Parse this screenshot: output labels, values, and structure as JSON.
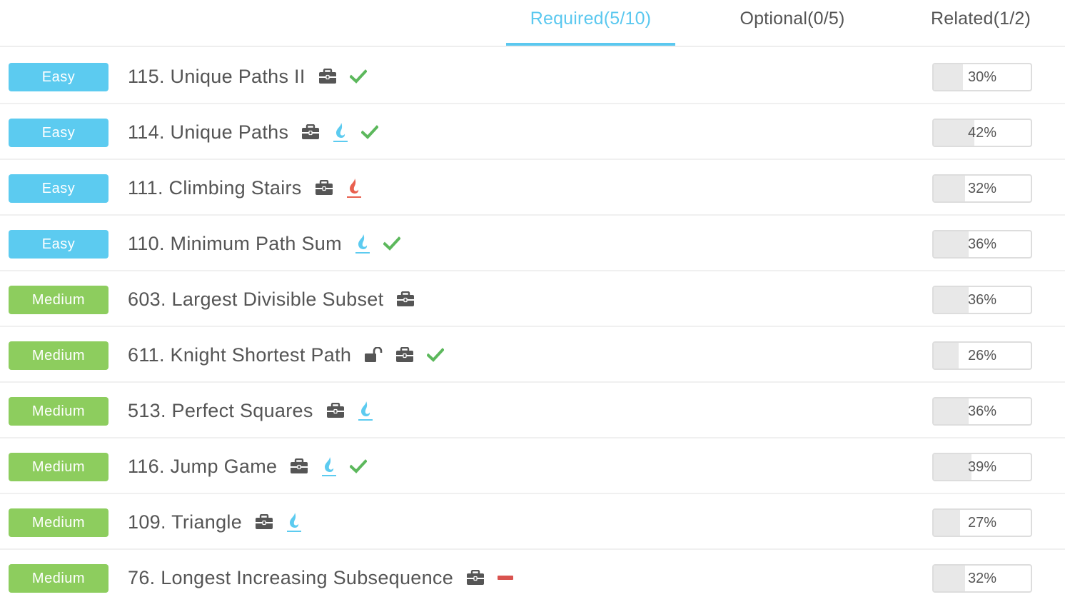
{
  "tabs": [
    {
      "label": "Required(5/10)",
      "active": true
    },
    {
      "label": "Optional(0/5)",
      "active": false
    },
    {
      "label": "Related(1/2)",
      "active": false
    }
  ],
  "colors": {
    "accent": "#5bc8ef",
    "easy": "#5ccbf0",
    "medium": "#8dcd5e",
    "check": "#5cb85c",
    "flame_blue": "#5ccbf0",
    "flame_red": "#e9604f",
    "dash_red": "#d9534f",
    "icon_gray": "#555555"
  },
  "problems": [
    {
      "difficulty": "Easy",
      "title": "115. Unique Paths II",
      "icons": [
        "briefcase-icon",
        "check-icon"
      ],
      "acceptance": "30%",
      "acceptance_value": 30
    },
    {
      "difficulty": "Easy",
      "title": "114. Unique Paths",
      "icons": [
        "briefcase-icon",
        "flame-blue-icon",
        "check-icon"
      ],
      "acceptance": "42%",
      "acceptance_value": 42
    },
    {
      "difficulty": "Easy",
      "title": "111. Climbing Stairs",
      "icons": [
        "briefcase-icon",
        "flame-red-icon"
      ],
      "acceptance": "32%",
      "acceptance_value": 32
    },
    {
      "difficulty": "Easy",
      "title": "110. Minimum Path Sum",
      "icons": [
        "flame-blue-icon",
        "check-icon"
      ],
      "acceptance": "36%",
      "acceptance_value": 36
    },
    {
      "difficulty": "Medium",
      "title": "603. Largest Divisible Subset",
      "icons": [
        "briefcase-icon"
      ],
      "acceptance": "36%",
      "acceptance_value": 36
    },
    {
      "difficulty": "Medium",
      "title": "611. Knight Shortest Path",
      "icons": [
        "unlock-icon",
        "briefcase-icon",
        "check-icon"
      ],
      "acceptance": "26%",
      "acceptance_value": 26
    },
    {
      "difficulty": "Medium",
      "title": "513. Perfect Squares",
      "icons": [
        "briefcase-icon",
        "flame-blue-icon"
      ],
      "acceptance": "36%",
      "acceptance_value": 36
    },
    {
      "difficulty": "Medium",
      "title": "116. Jump Game",
      "icons": [
        "briefcase-icon",
        "flame-blue-icon",
        "check-icon"
      ],
      "acceptance": "39%",
      "acceptance_value": 39
    },
    {
      "difficulty": "Medium",
      "title": "109. Triangle",
      "icons": [
        "briefcase-icon",
        "flame-blue-icon"
      ],
      "acceptance": "27%",
      "acceptance_value": 27
    },
    {
      "difficulty": "Medium",
      "title": "76. Longest Increasing Subsequence",
      "icons": [
        "briefcase-icon",
        "minus-icon"
      ],
      "acceptance": "32%",
      "acceptance_value": 32
    }
  ]
}
